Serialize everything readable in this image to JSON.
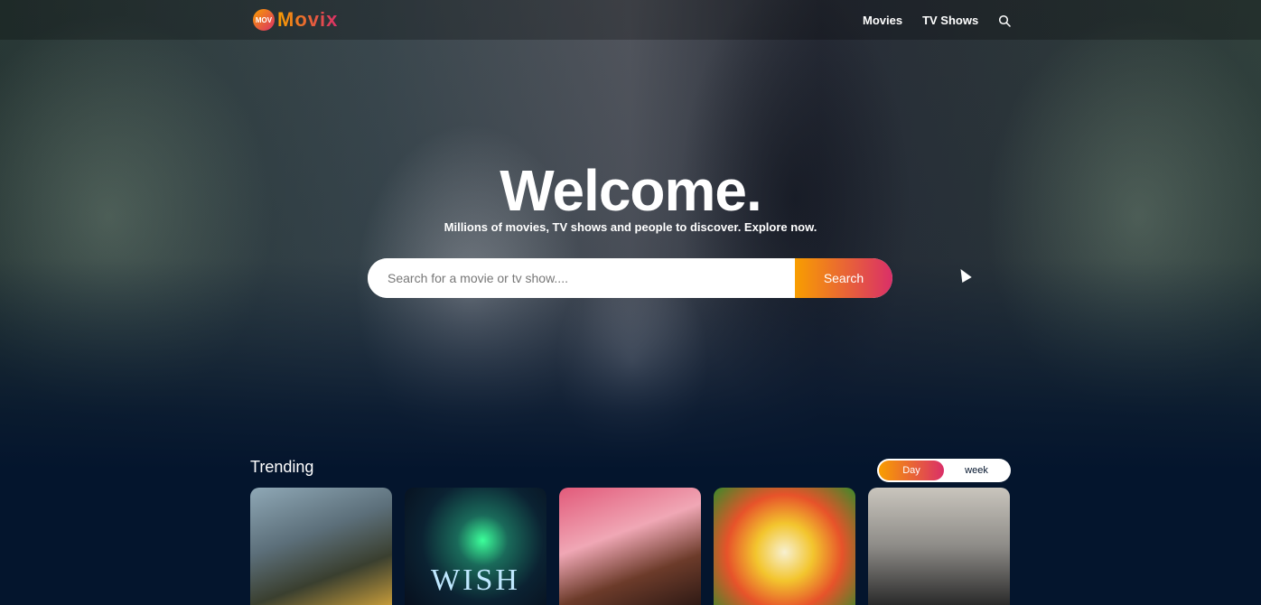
{
  "header": {
    "logo_text": "Movix",
    "logo_badge": "MOV",
    "nav": [
      "Movies",
      "TV Shows"
    ]
  },
  "hero": {
    "title": "Welcome.",
    "subtitle": "Millions of movies, TV shows and people to discover. Explore now.",
    "search_placeholder": "Search for a movie or tv show....",
    "search_button": "Search"
  },
  "trending": {
    "title": "Trending",
    "tabs": [
      "Day",
      "week"
    ],
    "active_tab": "Day",
    "cards": [
      {
        "poster_label": ""
      },
      {
        "poster_label": "WISH"
      },
      {
        "poster_label": ""
      },
      {
        "poster_label": ""
      },
      {
        "poster_label": ""
      }
    ]
  },
  "colors": {
    "background": "#04152d",
    "gradient_start": "#f89e00",
    "gradient_end": "#da2f68"
  },
  "icons": {
    "search": "search-icon",
    "logo": "movix-logo-icon"
  }
}
